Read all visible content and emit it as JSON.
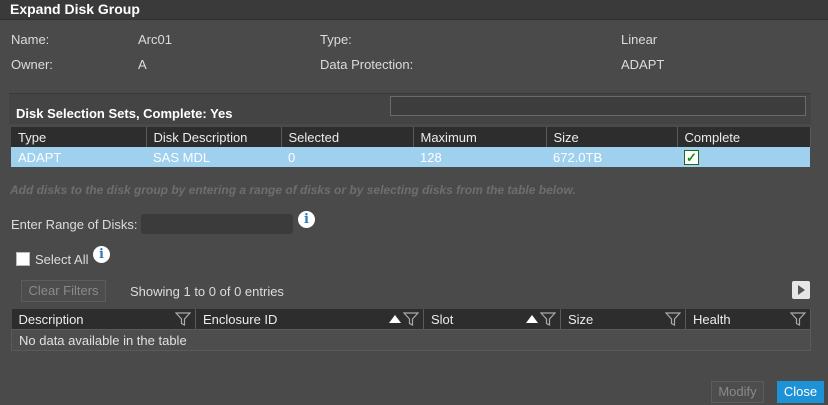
{
  "dialog": {
    "title": "Expand Disk Group"
  },
  "info": {
    "name_label": "Name:",
    "name_value": "Arc01",
    "type_label": "Type:",
    "type_value": "Linear",
    "owner_label": "Owner:",
    "owner_value": "A",
    "protection_label": "Data Protection:",
    "protection_value": "ADAPT"
  },
  "sets": {
    "title": "Disk Selection Sets, Complete: Yes",
    "columns": [
      "Type",
      "Disk Description",
      "Selected",
      "Maximum",
      "Size",
      "Complete"
    ],
    "row": {
      "type": "ADAPT",
      "description": "SAS MDL",
      "selected": "0",
      "maximum": "128",
      "size": "672.0TB",
      "complete": true
    }
  },
  "hint": "Add disks to the disk group by entering a range of disks or by selecting disks from the table below.",
  "range": {
    "label": "Enter Range of Disks:",
    "value": ""
  },
  "select_all": {
    "label": "Select All",
    "checked": false
  },
  "filters": {
    "clear_label": "Clear Filters",
    "showing": "Showing 1 to 0 of 0 entries"
  },
  "disks": {
    "columns": [
      "Description",
      "Enclosure ID",
      "Slot",
      "Size",
      "Health"
    ],
    "empty": "No data available in the table"
  },
  "buttons": {
    "modify": "Modify",
    "close": "Close"
  },
  "colors": {
    "selected_row": "#9fd0ee",
    "primary_button": "#1d92d6",
    "background": "#4a4a4a"
  }
}
